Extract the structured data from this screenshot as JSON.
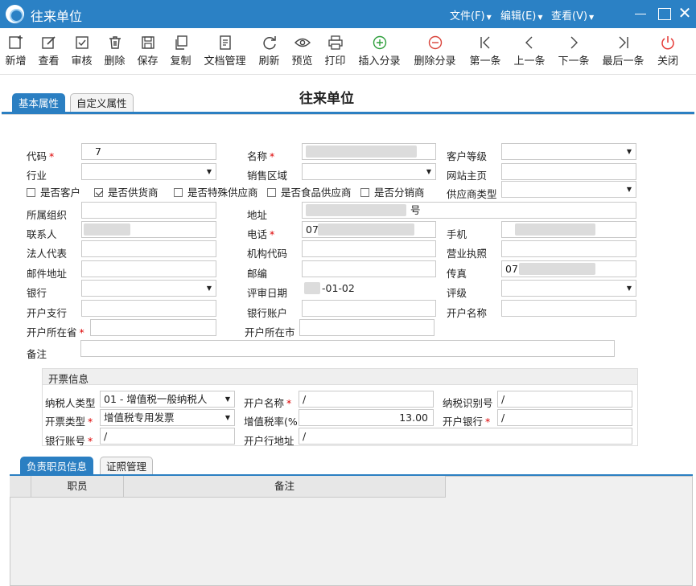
{
  "window": {
    "title": "往来单位",
    "menus": [
      "文件(F)",
      "编辑(E)",
      "查看(V)"
    ]
  },
  "toolbar": [
    {
      "label": "新增",
      "icon": "new-icon"
    },
    {
      "label": "查看",
      "icon": "view-icon"
    },
    {
      "label": "审核",
      "icon": "audit-icon"
    },
    {
      "label": "删除",
      "icon": "trash-icon"
    },
    {
      "label": "保存",
      "icon": "save-icon"
    },
    {
      "label": "复制",
      "icon": "copy-icon"
    },
    {
      "label": "文档管理",
      "icon": "document-icon"
    },
    {
      "label": "刷新",
      "icon": "refresh-icon"
    },
    {
      "label": "预览",
      "icon": "eye-icon"
    },
    {
      "label": "打印",
      "icon": "printer-icon"
    },
    {
      "label": "插入分录",
      "icon": "plus-circle-icon"
    },
    {
      "label": "删除分录",
      "icon": "minus-circle-icon"
    },
    {
      "label": "第一条",
      "icon": "first-icon"
    },
    {
      "label": "上一条",
      "icon": "prev-icon"
    },
    {
      "label": "下一条",
      "icon": "next-icon"
    },
    {
      "label": "最后一条",
      "icon": "last-icon"
    },
    {
      "label": "关闭",
      "icon": "power-icon"
    }
  ],
  "tabs": {
    "top": [
      "基本属性",
      "自定义属性"
    ],
    "bottom": [
      "负责职员信息",
      "证照管理"
    ]
  },
  "form_title": "往来单位",
  "labels": {
    "code": "代码",
    "name": "名称",
    "customer_level": "客户等级",
    "industry": "行业",
    "sales_region": "销售区域",
    "website": "网站主页",
    "supplier_type": "供应商类型",
    "org": "所属组织",
    "address": "地址",
    "contact": "联系人",
    "phone": "电话",
    "mobile": "手机",
    "legal_rep": "法人代表",
    "org_code": "机构代码",
    "license": "营业执照",
    "mail_address": "邮件地址",
    "postcode": "邮编",
    "fax": "传真",
    "bank": "银行",
    "review_date": "评审日期",
    "rating": "评级",
    "branch": "开户支行",
    "bank_account": "银行账户",
    "account_name": "开户名称",
    "province": "开户所在省",
    "city": "开户所在市",
    "remark": "备注"
  },
  "values": {
    "code": "7",
    "address": "号",
    "phone": "07",
    "fax": "07",
    "review_date": "-01-02"
  },
  "checkboxes": [
    {
      "label": "是否客户",
      "checked": false
    },
    {
      "label": "是否供货商",
      "checked": true
    },
    {
      "label": "是否特殊供应商",
      "checked": false
    },
    {
      "label": "是否食品供应商",
      "checked": false
    },
    {
      "label": "是否分销商",
      "checked": false
    }
  ],
  "invoice": {
    "title": "开票信息",
    "labels": {
      "taxpayer_type": "纳税人类型",
      "invoice_name": "开户名称",
      "tax_id": "纳税识别号",
      "invoice_type": "开票类型",
      "tax_rate": "增值税率(%",
      "invoice_bank": "开户银行",
      "account_no": "银行账号",
      "bank_address": "开户行地址"
    },
    "values": {
      "taxpayer_type": "01 - 增值税一般纳税人",
      "invoice_name": "/",
      "tax_id": "/",
      "invoice_type": "增值税专用发票",
      "tax_rate": "13.00",
      "invoice_bank": "/",
      "account_no": "/",
      "bank_address": "/"
    }
  },
  "grid": {
    "columns": [
      "职员",
      "备注"
    ]
  }
}
